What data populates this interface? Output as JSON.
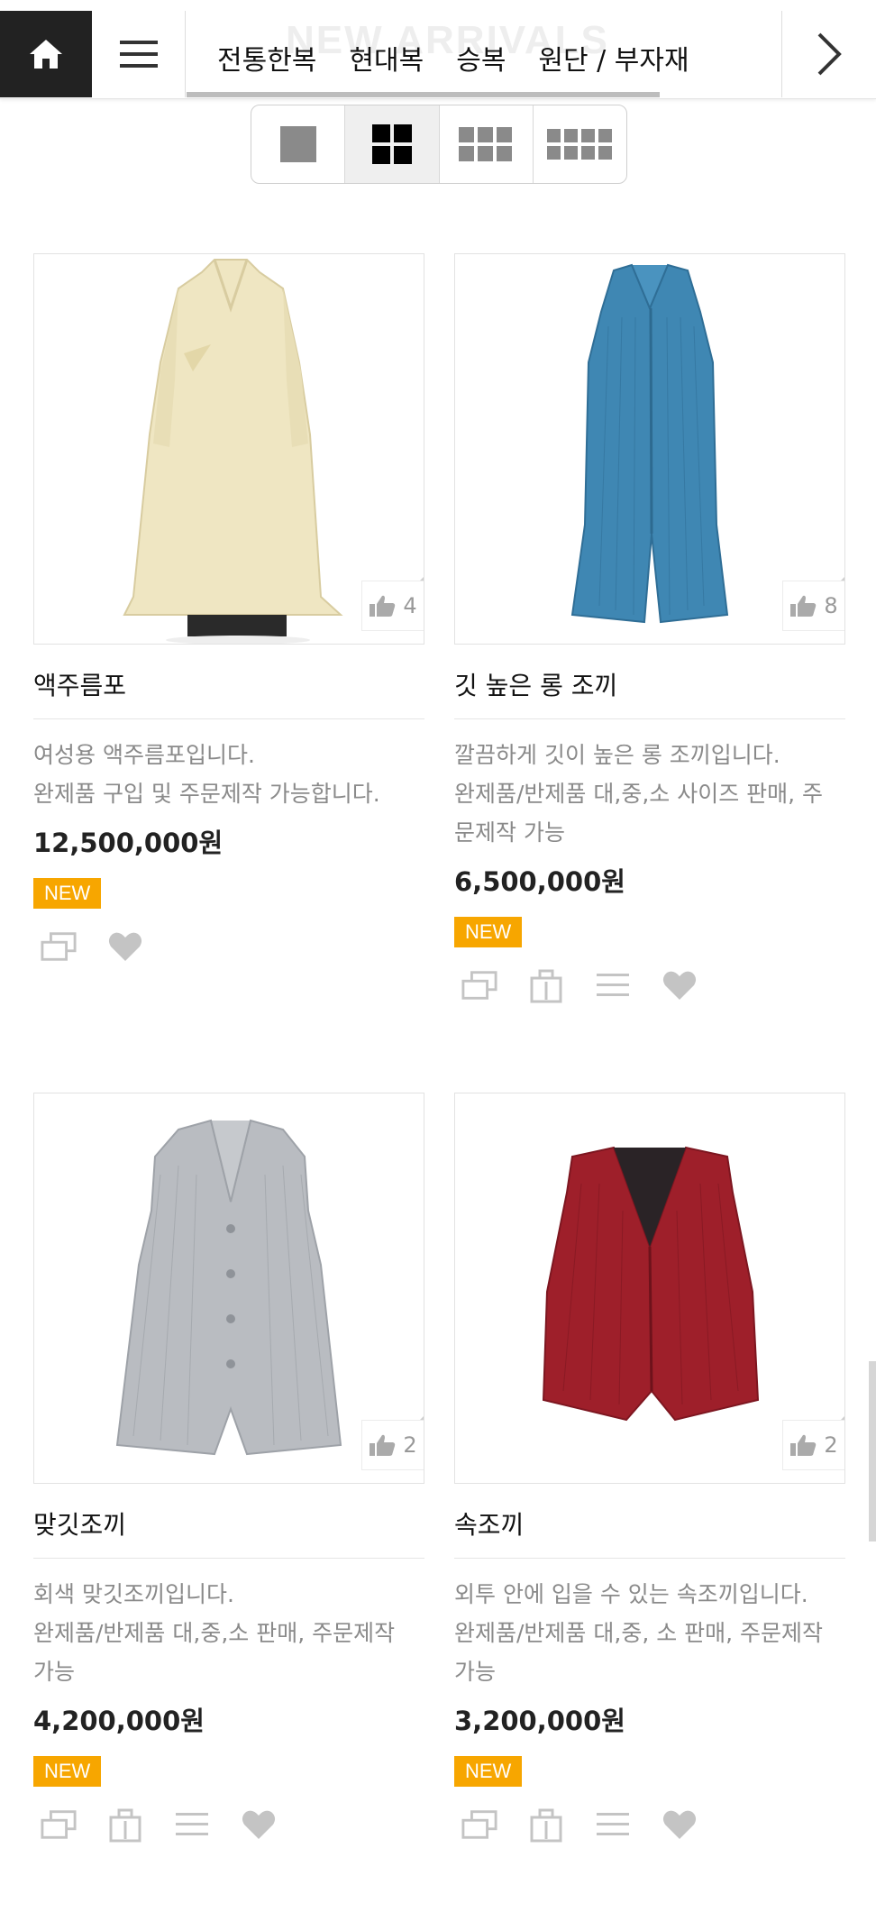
{
  "header": {
    "ghost_title": "NEW ARRIVALS",
    "categories": [
      "전통한복",
      "현대복",
      "승복",
      "원단 / 부자재"
    ]
  },
  "products": [
    {
      "name": "액주름포",
      "desc": [
        "여성용 액주름포입니다.",
        "완제품 구입 및 주문제작 가능합니다."
      ],
      "price": "12,500,000원",
      "badge": "NEW",
      "likes": "4",
      "garment_color": "#efe6c2"
    },
    {
      "name": "깃 높은 롱 조끼",
      "desc": [
        "깔끔하게 깃이 높은 롱 조끼입니다.",
        "완제품/반제품 대,중,소 사이즈 판매, 주",
        "문제작 가능"
      ],
      "price": "6,500,000원",
      "badge": "NEW",
      "likes": "8",
      "garment_color": "#3f87b3"
    },
    {
      "name": "맞깃조끼",
      "desc": [
        "회색 맞깃조끼입니다.",
        "완제품/반제품 대,중,소 판매, 주문제작",
        "가능"
      ],
      "price": "4,200,000원",
      "badge": "NEW",
      "likes": "2",
      "garment_color": "#b9bcc1"
    },
    {
      "name": "속조끼",
      "desc": [
        "외투 안에 입을 수 있는 속조끼입니다.",
        "완제품/반제품 대,중, 소 판매, 주문제작",
        "가능"
      ],
      "price": "3,200,000원",
      "badge": "NEW",
      "likes": "2",
      "garment_color": "#9e1f2a"
    }
  ],
  "colors": {
    "badge": "#f7a600",
    "home_bg": "#222222",
    "icon_gray": "#c4c4c4"
  }
}
